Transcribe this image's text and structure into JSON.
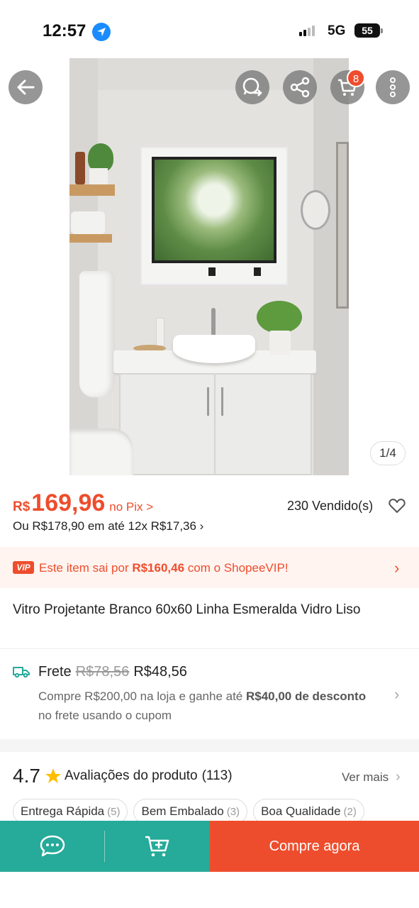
{
  "status_bar": {
    "time": "12:57",
    "network": "5G",
    "battery": "55"
  },
  "header": {
    "cart_count": "8"
  },
  "gallery": {
    "pager": "1/4"
  },
  "price": {
    "currency": "R$",
    "value": "169,96",
    "pix_label": "no Pix >",
    "sold": "230 Vendido(s)",
    "installments": "Ou R$178,90 em até 12x R$17,36 ›"
  },
  "vip": {
    "logo": "VIP",
    "text_before": "Este item sai por ",
    "price": "R$160,46",
    "text_after": " com o ShopeeVIP!",
    "chevron": "›"
  },
  "product": {
    "title": "Vitro Projetante Branco 60x60 Linha Esmeralda Vidro Liso"
  },
  "shipping": {
    "label": "Frete",
    "old_price": "R$78,56",
    "new_price": "R$48,56",
    "desc_1": "Compre R$200,00 na loja e ganhe até ",
    "desc_bold": "R$40,00 de desconto",
    "desc_2": " no frete usando o cupom",
    "chevron": "›"
  },
  "ratings": {
    "score": "4.7",
    "label": "Avaliações do produto",
    "count": "(113)",
    "see_more": "Ver mais",
    "chevron": "›",
    "chips": [
      {
        "label": "Entrega Rápida",
        "count": "(5)"
      },
      {
        "label": "Bem Embalado",
        "count": "(3)"
      },
      {
        "label": "Boa Qualidade",
        "count": "(2)"
      }
    ]
  },
  "bottom_bar": {
    "buy_label": "Compre agora"
  },
  "colors": {
    "brand": "#ee4d2d",
    "teal": "#26aa99"
  },
  "icons": [
    "location-arrow-icon",
    "back-arrow-icon",
    "whatsapp-share-icon",
    "share-icon",
    "cart-icon",
    "more-icon",
    "heart-icon",
    "truck-icon",
    "star-icon",
    "chat-icon",
    "add-to-cart-icon"
  ]
}
